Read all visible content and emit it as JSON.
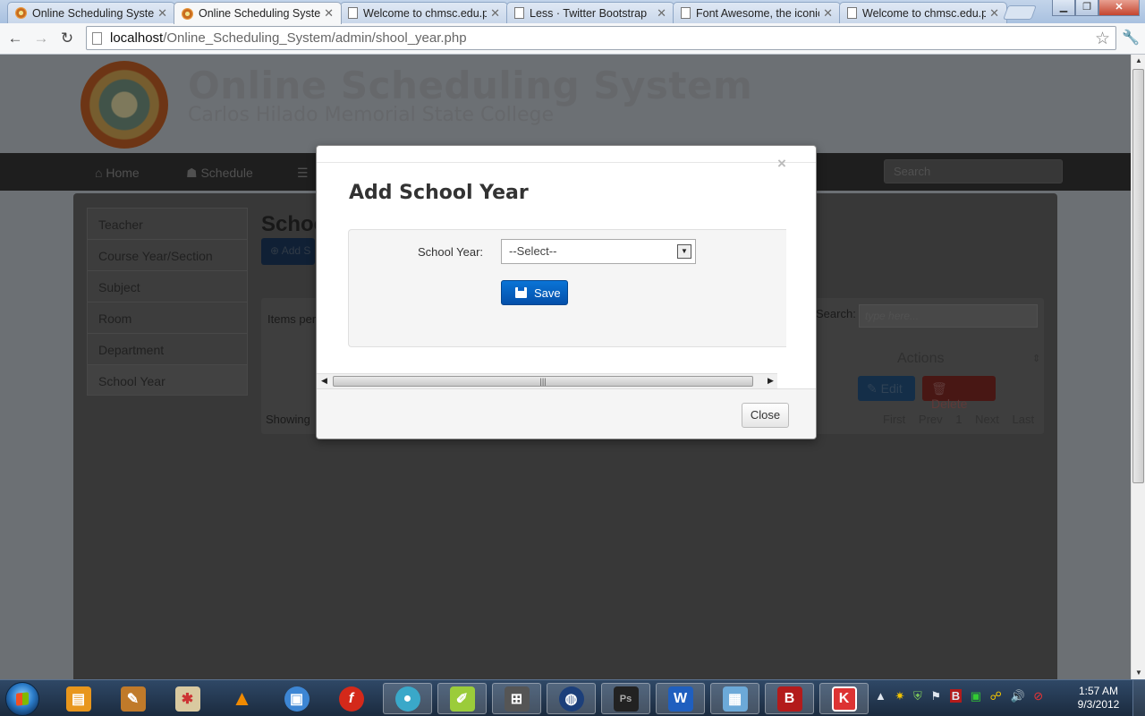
{
  "browser": {
    "tabs": [
      {
        "title": "Online Scheduling System",
        "favicon": "orange-seal",
        "active": false
      },
      {
        "title": "Online Scheduling System",
        "favicon": "orange-seal",
        "active": true
      },
      {
        "title": "Welcome to chmsc.edu.ph",
        "favicon": "page",
        "active": false
      },
      {
        "title": "Less · Twitter Bootstrap",
        "favicon": "page",
        "active": false
      },
      {
        "title": "Font Awesome, the iconic font",
        "favicon": "page",
        "active": false
      },
      {
        "title": "Welcome to chmsc.edu.ph",
        "favicon": "page",
        "active": false
      }
    ],
    "url_host": "localhost",
    "url_path": "/Online_Scheduling_System/admin/shool_year.php"
  },
  "site": {
    "title": "Online Scheduling System",
    "subtitle": "Carlos Hilado Memorial State College",
    "nav": [
      "Home",
      "Schedule"
    ],
    "search_placeholder": "Search"
  },
  "sidebar": {
    "items": [
      {
        "label": "Teacher"
      },
      {
        "label": "Course Year/Section"
      },
      {
        "label": "Subject"
      },
      {
        "label": "Room"
      },
      {
        "label": "Department"
      },
      {
        "label": "School Year"
      }
    ]
  },
  "main": {
    "heading": "Schoc",
    "add_button": "Add S",
    "items_label": "Items per",
    "search_label": "Search:",
    "search_placeholder": "type here...",
    "actions_header": "Actions",
    "edit_button": "Edit",
    "delete_button": "Delete",
    "showing_label": "Showing",
    "pager": [
      "First",
      "Prev",
      "1",
      "Next",
      "Last"
    ]
  },
  "modal": {
    "close_x": "×",
    "title": "Add School Year",
    "field_label": "School Year:",
    "select_value": "--Select--",
    "save_button": "Save",
    "close_button": "Close"
  },
  "taskbar": {
    "time": "1:57 AM",
    "date": "9/3/2012"
  },
  "colors": {
    "primary_button": "#0a6fd0",
    "backdrop": "#000000",
    "navbar": "#3a3a3a"
  }
}
